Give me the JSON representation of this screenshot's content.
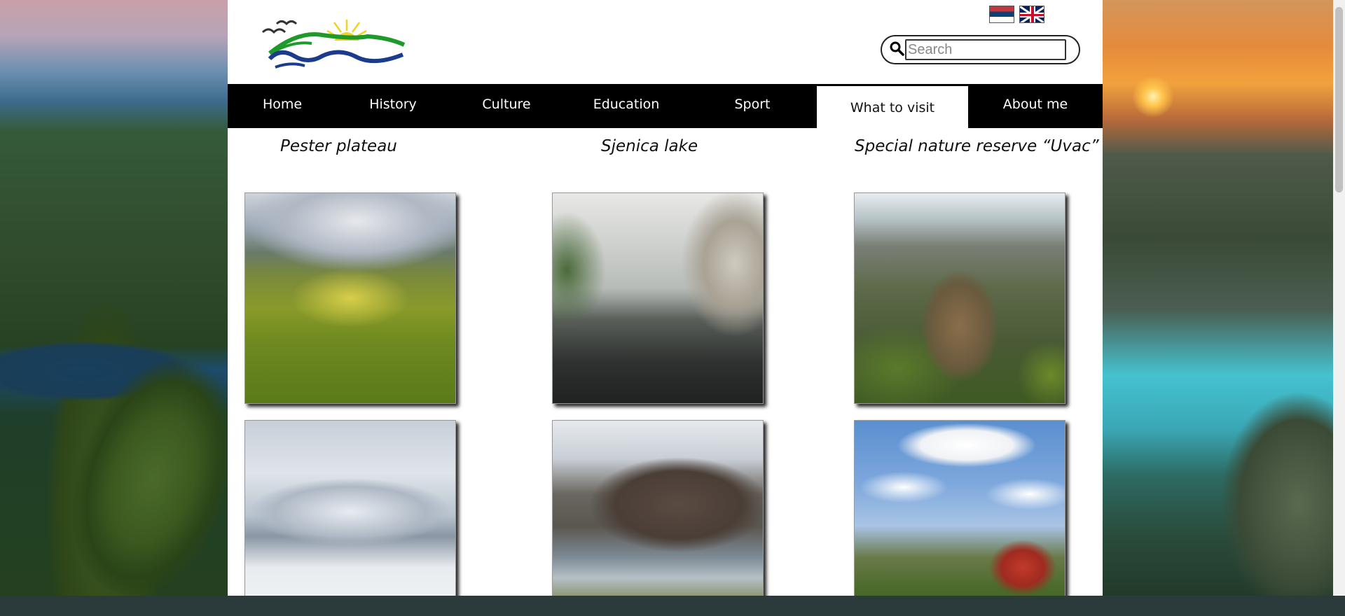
{
  "header": {
    "logo_name": "site-logo",
    "languages": [
      {
        "code": "sr",
        "name": "Serbian flag"
      },
      {
        "code": "en",
        "name": "English flag"
      }
    ]
  },
  "search": {
    "placeholder": "Search",
    "value": ""
  },
  "nav": {
    "items": [
      {
        "label": "Home",
        "active": false
      },
      {
        "label": "History",
        "active": false
      },
      {
        "label": "Culture",
        "active": false
      },
      {
        "label": "Education",
        "active": false
      },
      {
        "label": "Sport",
        "active": false
      },
      {
        "label": "What to visit",
        "active": true
      },
      {
        "label": "About me",
        "active": false
      }
    ]
  },
  "main": {
    "sections": [
      {
        "title": "Pester plateau"
      },
      {
        "title": "Sjenica lake"
      },
      {
        "title": "Special nature reserve “Uvac”"
      }
    ]
  },
  "colors": {
    "nav_bg": "#000000",
    "nav_text": "#ffffff",
    "page_bg": "#ffffff"
  }
}
